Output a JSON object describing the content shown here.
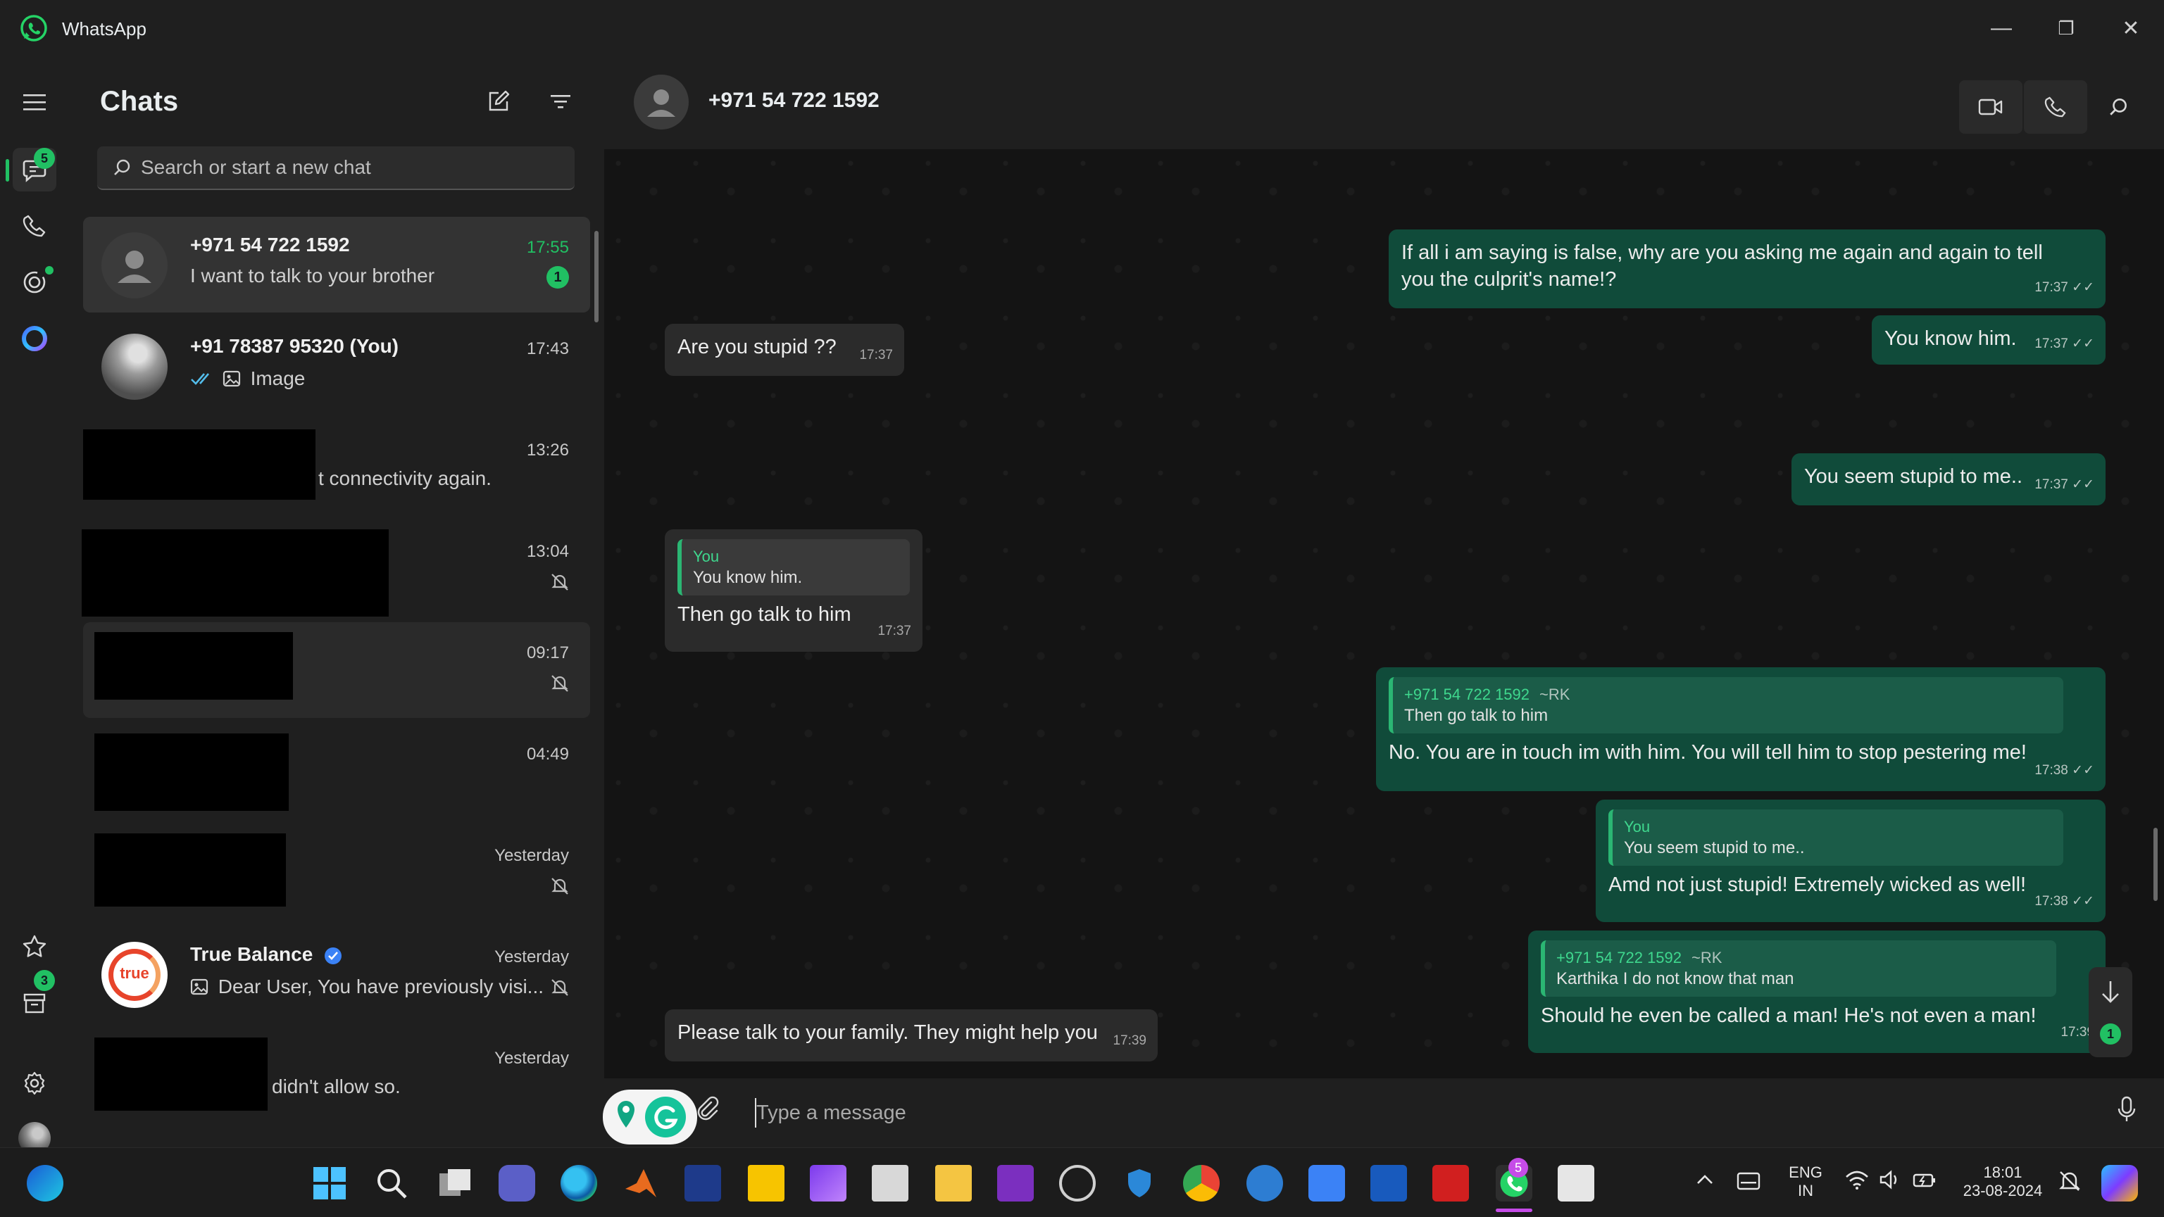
{
  "window": {
    "app_title": "WhatsApp",
    "minimize_label": "—",
    "restore_label": "❐",
    "close_label": "✕"
  },
  "rail": {
    "chats_badge": "5",
    "archive_badge": "3"
  },
  "sidebar": {
    "title": "Chats",
    "search_placeholder": "Search or start a new chat"
  },
  "chats": [
    {
      "name": "+971 54 722 1592",
      "preview": "I want to talk to your brother",
      "time": "17:55",
      "unread": "1"
    },
    {
      "name": "+91 78387 95320 (You)",
      "preview": "Image",
      "time": "17:43"
    },
    {
      "preview": "t connectivity again.",
      "time": "13:26"
    },
    {
      "time": "13:04"
    },
    {
      "time": "09:17"
    },
    {
      "time": "04:49"
    },
    {
      "time": "Yesterday"
    },
    {
      "name": "True Balance",
      "preview": "Dear User,  You have previously visi...",
      "time": "Yesterday",
      "avatar_text": "true"
    },
    {
      "preview": "didn't allow so.",
      "time": "Yesterday"
    }
  ],
  "conversation": {
    "contact": "+971 54 722 1592",
    "messages": [
      {
        "dir": "out",
        "text": "If all i am saying is false, why are you asking me again and again to tell you the culprit's name!?",
        "time": "17:37 ✓✓"
      },
      {
        "dir": "out",
        "text": "You know him.",
        "time": "17:37 ✓✓"
      },
      {
        "dir": "in",
        "text": "Are you stupid ??",
        "time": "17:37"
      },
      {
        "dir": "out",
        "text": "You seem stupid to me..",
        "time": "17:37 ✓✓"
      },
      {
        "dir": "in",
        "quote_author": "You",
        "quote_text": "You know him.",
        "text": "Then go talk to him",
        "time": "17:37"
      },
      {
        "dir": "out",
        "quote_author": "+971 54 722 1592",
        "quote_tag": "~RK",
        "quote_text": "Then go talk to him",
        "text": "No. You are in touch im with him. You will tell him to stop pestering me!",
        "time": "17:38 ✓✓"
      },
      {
        "dir": "out",
        "quote_author": "You",
        "quote_text": "You seem stupid to me..",
        "text": "Amd not just stupid! Extremely wicked as well!",
        "time": "17:38 ✓✓"
      },
      {
        "dir": "out",
        "quote_author": "+971 54 722 1592",
        "quote_tag": "~RK",
        "quote_text": "Karthika I do not know that man",
        "text": "Should he even be called a man! He's not even a man!",
        "time": "17:39"
      },
      {
        "dir": "in",
        "text": "Please talk to your family. They might help you",
        "time": "17:39"
      }
    ],
    "scroll_unread": "1",
    "composer_placeholder": "Type a message"
  },
  "taskbar": {
    "lang_top": "ENG",
    "lang_bottom": "IN",
    "time": "18:01",
    "date": "23-08-2024",
    "whatsapp_badge": "5"
  },
  "colors": {
    "accent": "#21c063",
    "outgoing_bubble": "#104b3a",
    "incoming_bubble": "#2b2b2b"
  }
}
